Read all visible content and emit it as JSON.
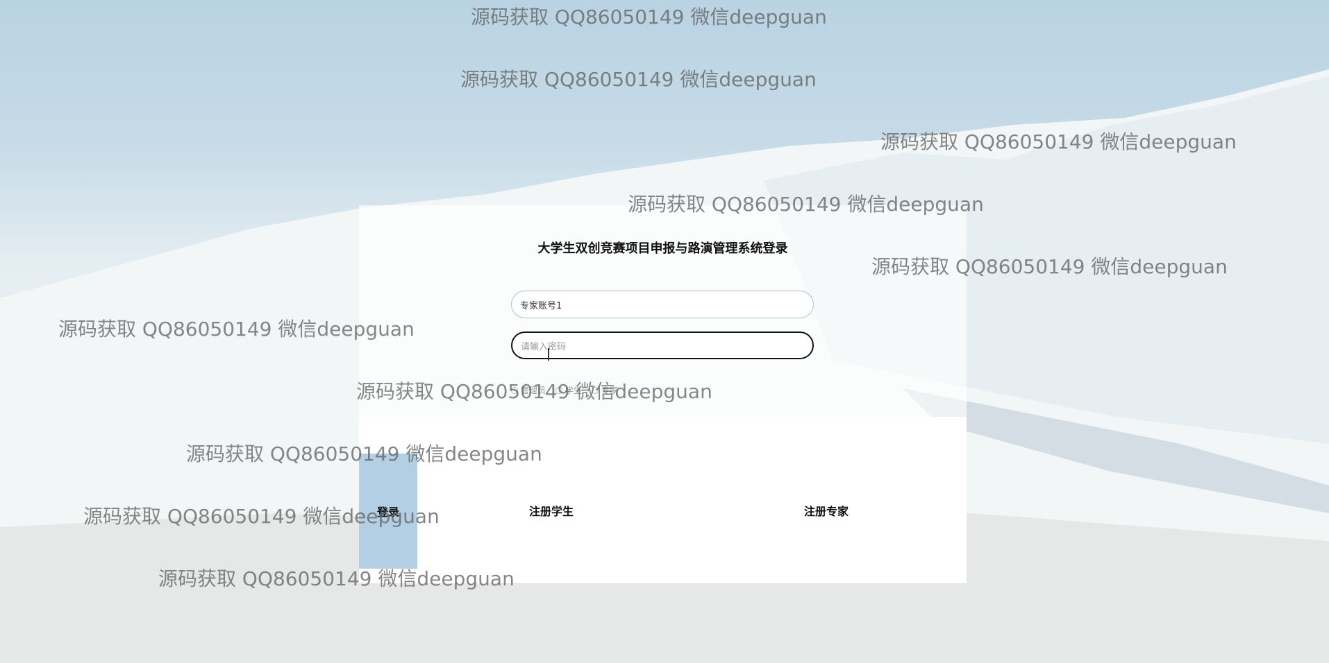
{
  "login": {
    "title": "大学生双创竞赛项目申报与路演管理系统登录",
    "account_value": "专家账号1",
    "password_placeholder": "请输入密码",
    "roles": [
      "管理员",
      "学生",
      "专家"
    ],
    "login_label": "登录",
    "register_student_label": "注册学生",
    "register_expert_label": "注册专家"
  },
  "watermark": {
    "text": "源码获取 QQ86050149 微信deepguan"
  },
  "colors": {
    "login_button_bg": "#b2cfe4",
    "password_border": "#111111",
    "account_border": "#a9c3d3"
  }
}
